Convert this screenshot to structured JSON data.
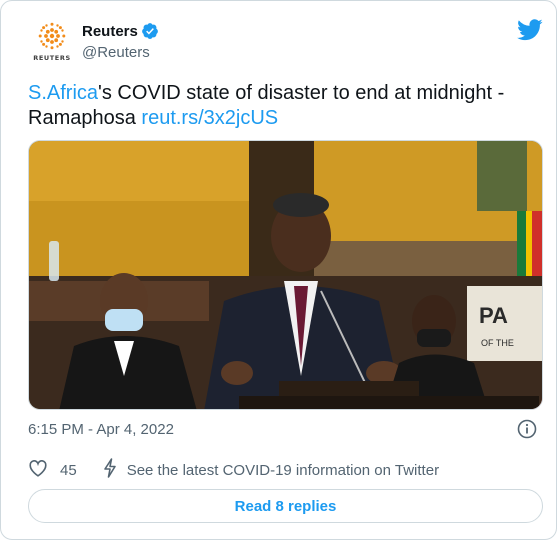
{
  "author": {
    "display_name": "Reuters",
    "handle": "@Reuters",
    "logo_word": "REUTERS",
    "verified": true
  },
  "tweet": {
    "text_link_1": "S.Africa",
    "text_part_1": "'s COVID state of disaster to end at midnight - Ramaphosa ",
    "text_link_2": "reut.rs/3x2jcUS"
  },
  "media": {
    "sign_text": "PA",
    "sign_subtext": "OF THE"
  },
  "meta": {
    "timestamp": "6:15 PM - Apr 4, 2022"
  },
  "actions": {
    "like_count": "45",
    "covid_info": "See the latest COVID-19 information on Twitter"
  },
  "replies": {
    "label": "Read 8 replies"
  },
  "icons": {
    "verified": "verified-badge-icon",
    "twitter": "twitter-bird-icon",
    "info": "info-icon",
    "like": "heart-icon",
    "covid": "lightning-icon"
  },
  "colors": {
    "accent": "#1d9bf0",
    "text": "#0f1419",
    "secondary_text": "#536471",
    "border": "#cfd9de",
    "reuters_orange": "#f28c1a"
  }
}
